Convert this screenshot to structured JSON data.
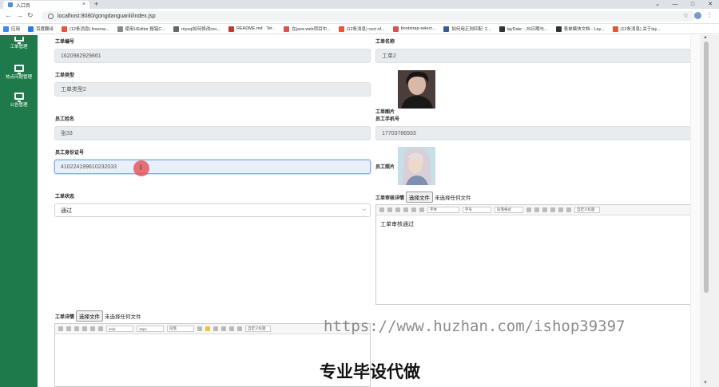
{
  "browser": {
    "tab_title": "入口页",
    "tab_close": "×",
    "new_tab": "+",
    "url": "localhost:8080/gongdanguanli/index.jsp",
    "window_controls": [
      "⌄",
      "—",
      "□",
      "✕"
    ],
    "star": "☆",
    "menu": "⋮",
    "nav": {
      "back": "←",
      "forward": "→",
      "reload": "↻"
    }
  },
  "bookmarks": [
    {
      "label": "应用",
      "color": "#4285f4"
    },
    {
      "label": "百度翻译",
      "color": "#2d7be5"
    },
    {
      "label": "(12条消息) freema...",
      "color": "#e8543a"
    },
    {
      "label": "使用UEditor 报错C...",
      "color": "#888888"
    },
    {
      "label": "mysql如何修改roo...",
      "color": "#666666"
    },
    {
      "label": "README.md · Ter...",
      "color": "#c0392b"
    },
    {
      "label": "在java web项目中...",
      "color": "#d9534f"
    },
    {
      "label": "(12条消息) root of...",
      "color": "#e8543a"
    },
    {
      "label": "bootstrap-select...",
      "color": "#d9534f"
    },
    {
      "label": "如何用正则匹配: 2...",
      "color": "#3b5998"
    },
    {
      "label": "layDate - JS日期与...",
      "color": "#333333"
    },
    {
      "label": "表单模块文档 - Lay...",
      "color": "#333333"
    },
    {
      "label": "(12条消息) 关于lay...",
      "color": "#e8543a"
    }
  ],
  "sidebar": {
    "items": [
      {
        "label": "工单管理"
      },
      {
        "label": "热点问题管理"
      },
      {
        "label": "公告管理"
      }
    ]
  },
  "form": {
    "order_no_label": "工单编号",
    "order_no_value": "1620982929861",
    "order_name_label": "工单名称",
    "order_name_value": "工单2",
    "order_type_label": "工单类型",
    "order_type_value": "工单类型2",
    "order_image_label": "工单图片",
    "staff_name_label": "员工姓名",
    "staff_name_value": "张33",
    "staff_phone_label": "员工手机号",
    "staff_phone_value": "17703786933",
    "staff_id_label": "员工身份证号",
    "staff_id_value": "410224199610232033",
    "staff_photo_label": "员工照片",
    "status_label": "工单状态",
    "status_value": "通过",
    "review_label": "工单审核详情",
    "review_file_button": "选择文件",
    "review_file_status": "未选择任何文件",
    "review_content": "工单审核通过",
    "detail_label": "工单详情",
    "detail_file_button": "选择文件",
    "detail_file_status": "未选择任何文件"
  },
  "editor_toolbar": {
    "font_family": "arial",
    "font_size": "16px",
    "paragraph": "段落",
    "custom_title": "自定义标题",
    "review_font": "字体",
    "review_size": "字号",
    "review_para": "段落格式",
    "review_custom": "自定义标题"
  },
  "overlay": {
    "watermark": "https://www.huzhan.com/ishop39397",
    "caption": "专业毕设代做"
  }
}
